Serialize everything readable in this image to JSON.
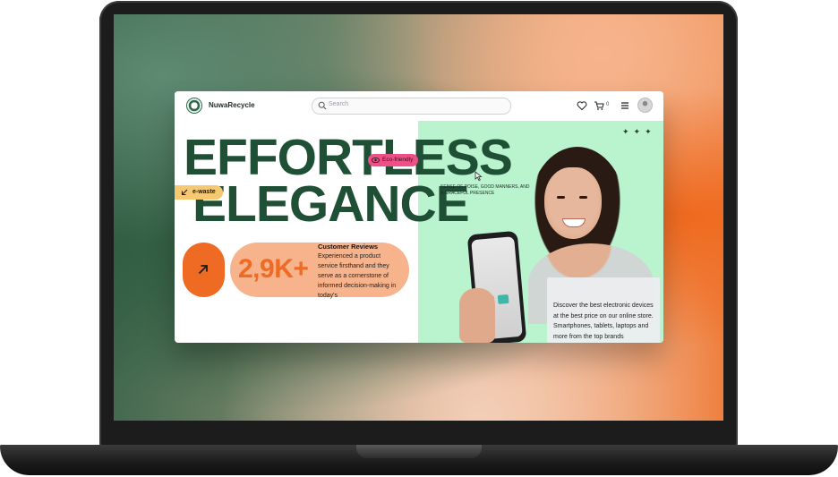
{
  "site": {
    "brand": "NuwaRecycle",
    "search_placeholder": "Search",
    "cart_count": "0",
    "icons": [
      "heart-icon",
      "cart-icon",
      "menu-icon",
      "avatar-icon",
      "search-icon"
    ]
  },
  "hero": {
    "headline_line1": "EFFORTLESS",
    "headline_line2": "ELEGANCE",
    "chip_eco": "Eco-friendly",
    "chip_ewaste": "e-waste",
    "tagline": "SENSE OF POISE, GOOD MANNERS, AND A GRACEFUL PRESENCE",
    "sparkles": "✦✦✦"
  },
  "stats": {
    "value": "2,9K+",
    "reviews_title": "Customer Reviews",
    "reviews_text": "Experienced a product service firsthand and they serve as a cornerstone of informed decision-making in today's"
  },
  "promo": {
    "text": "Discover the best electronic devices at the best price on our online store. Smartphones, tablets, laptops and more from the top brands"
  },
  "colors": {
    "headline": "#1f4f35",
    "accent_orange": "#ef6a22",
    "mint": "#b9f4cf",
    "pink": "#ef4f87",
    "yellow": "#f6c871",
    "peach": "#f6b38c"
  }
}
